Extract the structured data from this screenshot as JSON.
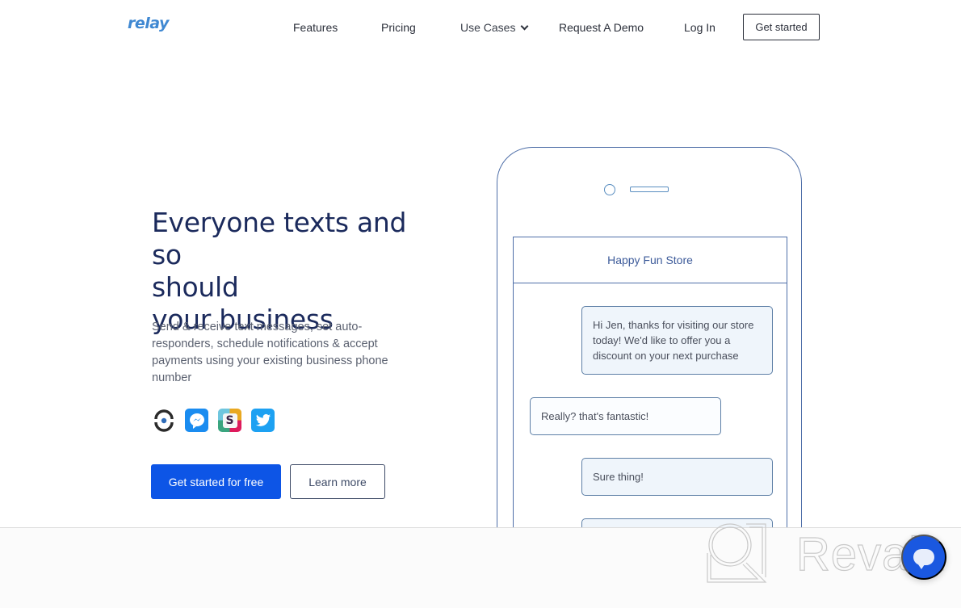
{
  "nav": {
    "logo": "relay",
    "links": [
      "Features",
      "Pricing",
      "Use Cases",
      "Request A Demo",
      "Log In"
    ],
    "cta": "Get started"
  },
  "hero": {
    "title_lines": [
      "Everyone texts and so",
      "should",
      "your business"
    ],
    "description": "Send & receive text messages, set auto-responders, schedule notifications & accept payments using your existing business phone number",
    "integrations": [
      "sync-icon",
      "messenger-icon",
      "slack-icon",
      "twitter-icon"
    ],
    "primary_button": "Get started for free",
    "secondary_button": "Learn more"
  },
  "phone": {
    "store_name": "Happy Fun Store",
    "messages": [
      {
        "direction": "outgoing",
        "text": "Hi Jen, thanks for visiting our store today! We'd like to offer you a discount on your next purchase"
      },
      {
        "direction": "incoming",
        "text": "Really? that's fantastic!"
      },
      {
        "direction": "outgoing",
        "text": "Sure thing!"
      },
      {
        "direction": "outgoing",
        "text": ""
      }
    ]
  },
  "watermark": {
    "text": "Revain"
  },
  "colors": {
    "brand": "#3f88d2",
    "primary_button": "#0d55e6",
    "heading": "#1b2a5c",
    "phone_outline": "#4f6fa8",
    "chat_fab": "#1a58e0"
  }
}
